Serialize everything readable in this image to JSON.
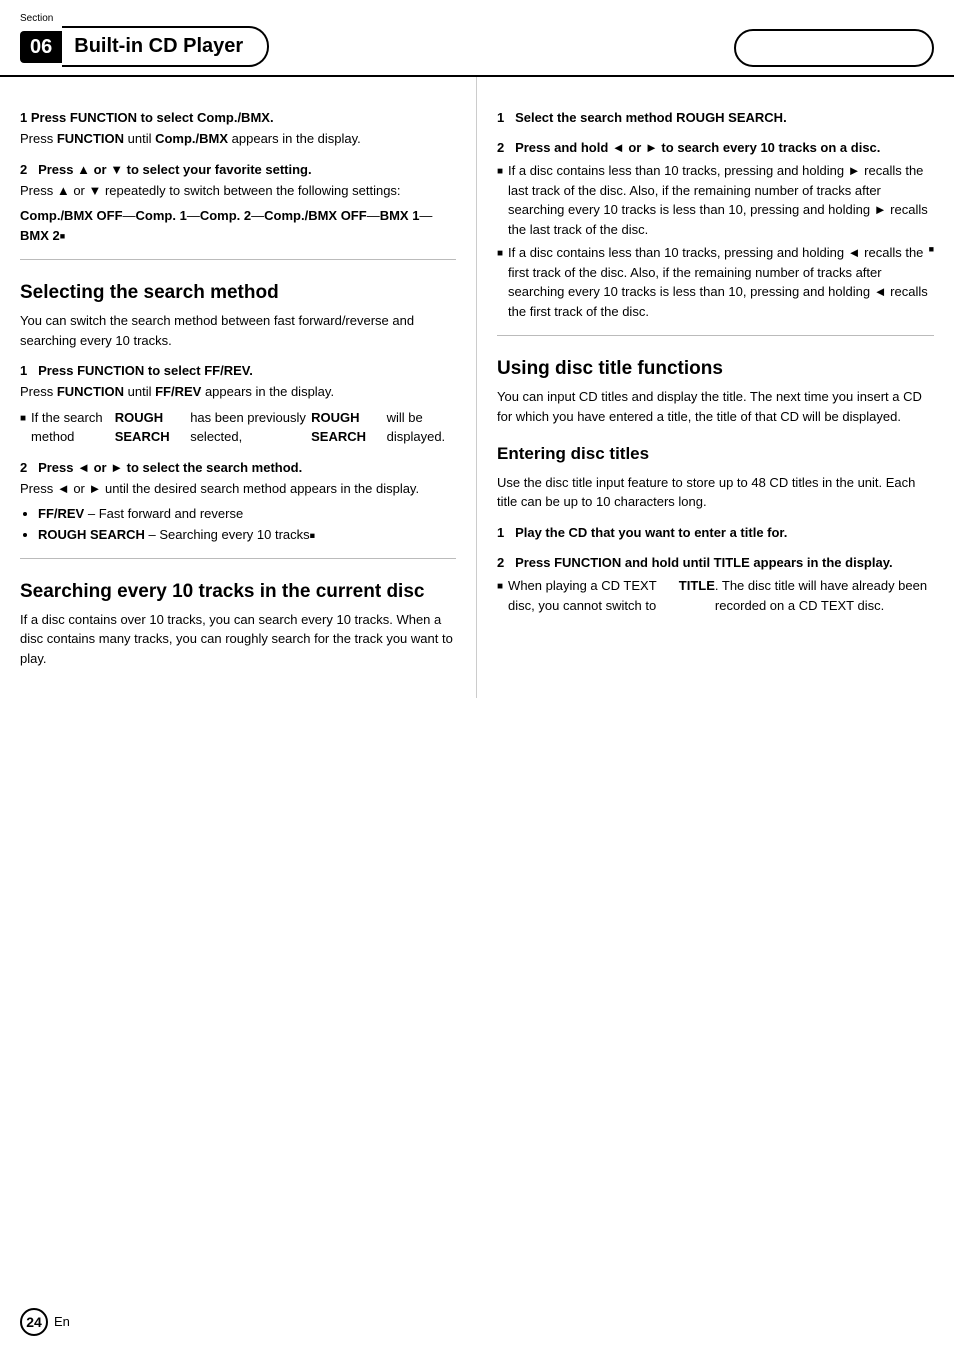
{
  "header": {
    "section_label": "Section",
    "section_number": "06",
    "title": "Built-in CD Player",
    "oval_text": ""
  },
  "left_col": {
    "block1": {
      "step1_heading": "1   Press FUNCTION to select Comp./BMX.",
      "step1_body": "Press FUNCTION until Comp./BMX appears in the display.",
      "step2_heading": "2   Press ▲ or ▼ to select your favorite setting.",
      "step2_body": "Press ▲ or ▼ repeatedly to switch between the following settings:",
      "step2_settings": "Comp./BMX OFF—Comp. 1—Comp. 2—Comp./BMX OFF—BMX 1—BMX 2■"
    },
    "selecting_section": {
      "heading": "Selecting the search method",
      "intro": "You can switch the search method between fast forward/reverse and searching every 10 tracks.",
      "step1_heading": "1   Press FUNCTION to select FF/REV.",
      "step1_body_1": "Press FUNCTION until FF/REV appears in the display.",
      "step1_body_2": "■ If the search method ROUGH SEARCH has been previously selected, ROUGH SEARCH will be displayed.",
      "step2_heading": "2   Press ◄ or ► to select the search method.",
      "step2_body": "Press ◄ or ► until the desired search method appears in the display.",
      "bullets": [
        "FF/REV – Fast forward and reverse",
        "ROUGH SEARCH – Searching every 10 tracks■"
      ]
    },
    "searching_section": {
      "heading": "Searching every 10 tracks in the current disc",
      "intro": "If a disc contains over 10 tracks, you can search every 10 tracks. When a disc contains many tracks, you can roughly search for the track you want to play."
    }
  },
  "right_col": {
    "rough_search": {
      "step1_heading": "1   Select the search method ROUGH SEARCH.",
      "step2_heading": "2   Press and hold ◄ or ► to search every 10 tracks on a disc.",
      "bullet1": "If a disc contains less than 10 tracks, pressing and holding ► recalls the last track of the disc. Also, if the remaining number of tracks after searching every 10 tracks is less than 10, pressing and holding ► recalls the last track of the disc.",
      "bullet2": "If a disc contains less than 10 tracks, pressing and holding ◄ recalls the first track of the disc. Also, if the remaining number of tracks after searching every 10 tracks is less than 10, pressing and holding ◄ recalls the first track of the disc.■"
    },
    "disc_title_section": {
      "heading": "Using disc title functions",
      "intro": "You can input CD titles and display the title. The next time you insert a CD for which you have entered a title, the title of that CD will be displayed.",
      "entering_heading": "Entering disc titles",
      "entering_intro": "Use the disc title input feature to store up to 48 CD titles in the unit. Each title can be up to 10 characters long.",
      "step1_heading": "1   Play the CD that you want to enter a title for.",
      "step2_heading": "2   Press FUNCTION and hold until TITLE appears in the display.",
      "step2_bullet": "When playing a CD TEXT disc, you cannot switch to TITLE. The disc title will have already been recorded on a CD TEXT disc."
    }
  },
  "footer": {
    "page_number": "24",
    "lang": "En"
  }
}
